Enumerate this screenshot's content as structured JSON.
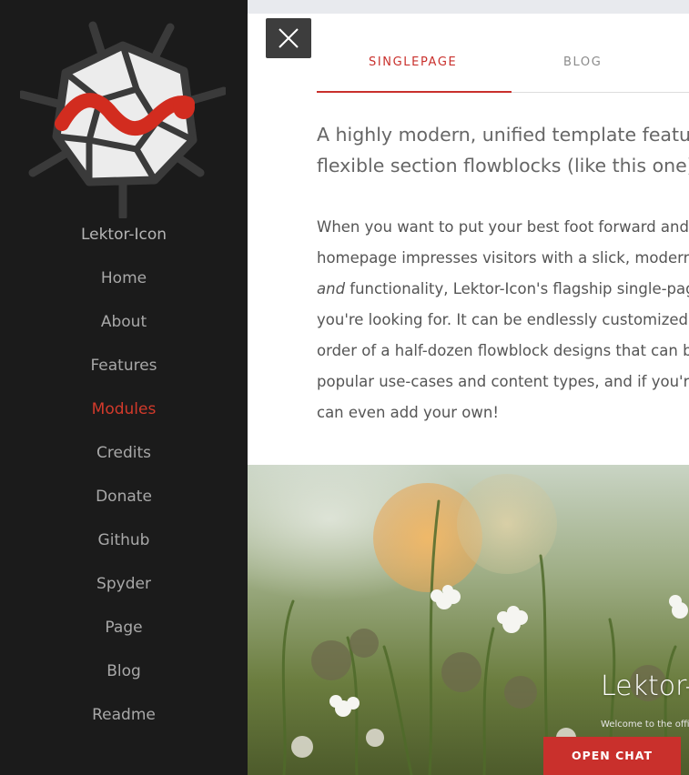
{
  "sidebar": {
    "brand": "Lektor-Icon",
    "nav": [
      {
        "label": "Home"
      },
      {
        "label": "About"
      },
      {
        "label": "Features"
      },
      {
        "label": "Modules",
        "active": true
      },
      {
        "label": "Credits"
      },
      {
        "label": "Donate"
      },
      {
        "label": "Github"
      },
      {
        "label": "Spyder"
      },
      {
        "label": "Page"
      },
      {
        "label": "Blog"
      },
      {
        "label": "Readme"
      }
    ]
  },
  "close_button": {
    "icon": "close-icon"
  },
  "tabs": [
    {
      "label": "SINGLEPAGE",
      "active": true
    },
    {
      "label": "BLOG",
      "active": false
    }
  ],
  "content": {
    "lead_lines": [
      "A highly modern, unified template featuri",
      "flexible section flowblocks (like this one)."
    ],
    "body_lines": [
      {
        "before": "When you want to put your best foot forward and",
        "em": "",
        "after": ""
      },
      {
        "before": "homepage impresses visitors with a slick, modern",
        "em": "",
        "after": ""
      },
      {
        "before": "",
        "em": "and",
        "after": " functionality, Lektor-Icon's flagship single-pag"
      },
      {
        "before": "you're looking for. It can be endlessly customized",
        "em": "",
        "after": ""
      },
      {
        "before": "order of a half-dozen flowblock designs that can b",
        "em": "",
        "after": ""
      },
      {
        "before": "popular use-cases and content types, and if you'r",
        "em": "",
        "after": ""
      },
      {
        "before": "can even add your own!",
        "em": "",
        "after": ""
      }
    ]
  },
  "hero": {
    "title": "Lektor-",
    "subtitle": "Welcome to the offi"
  },
  "chat": {
    "label": "OPEN CHAT"
  },
  "colors": {
    "accent": "#c9302c",
    "sidebar_bg": "#1b1b1b",
    "nav_text": "#a8a8a8"
  }
}
